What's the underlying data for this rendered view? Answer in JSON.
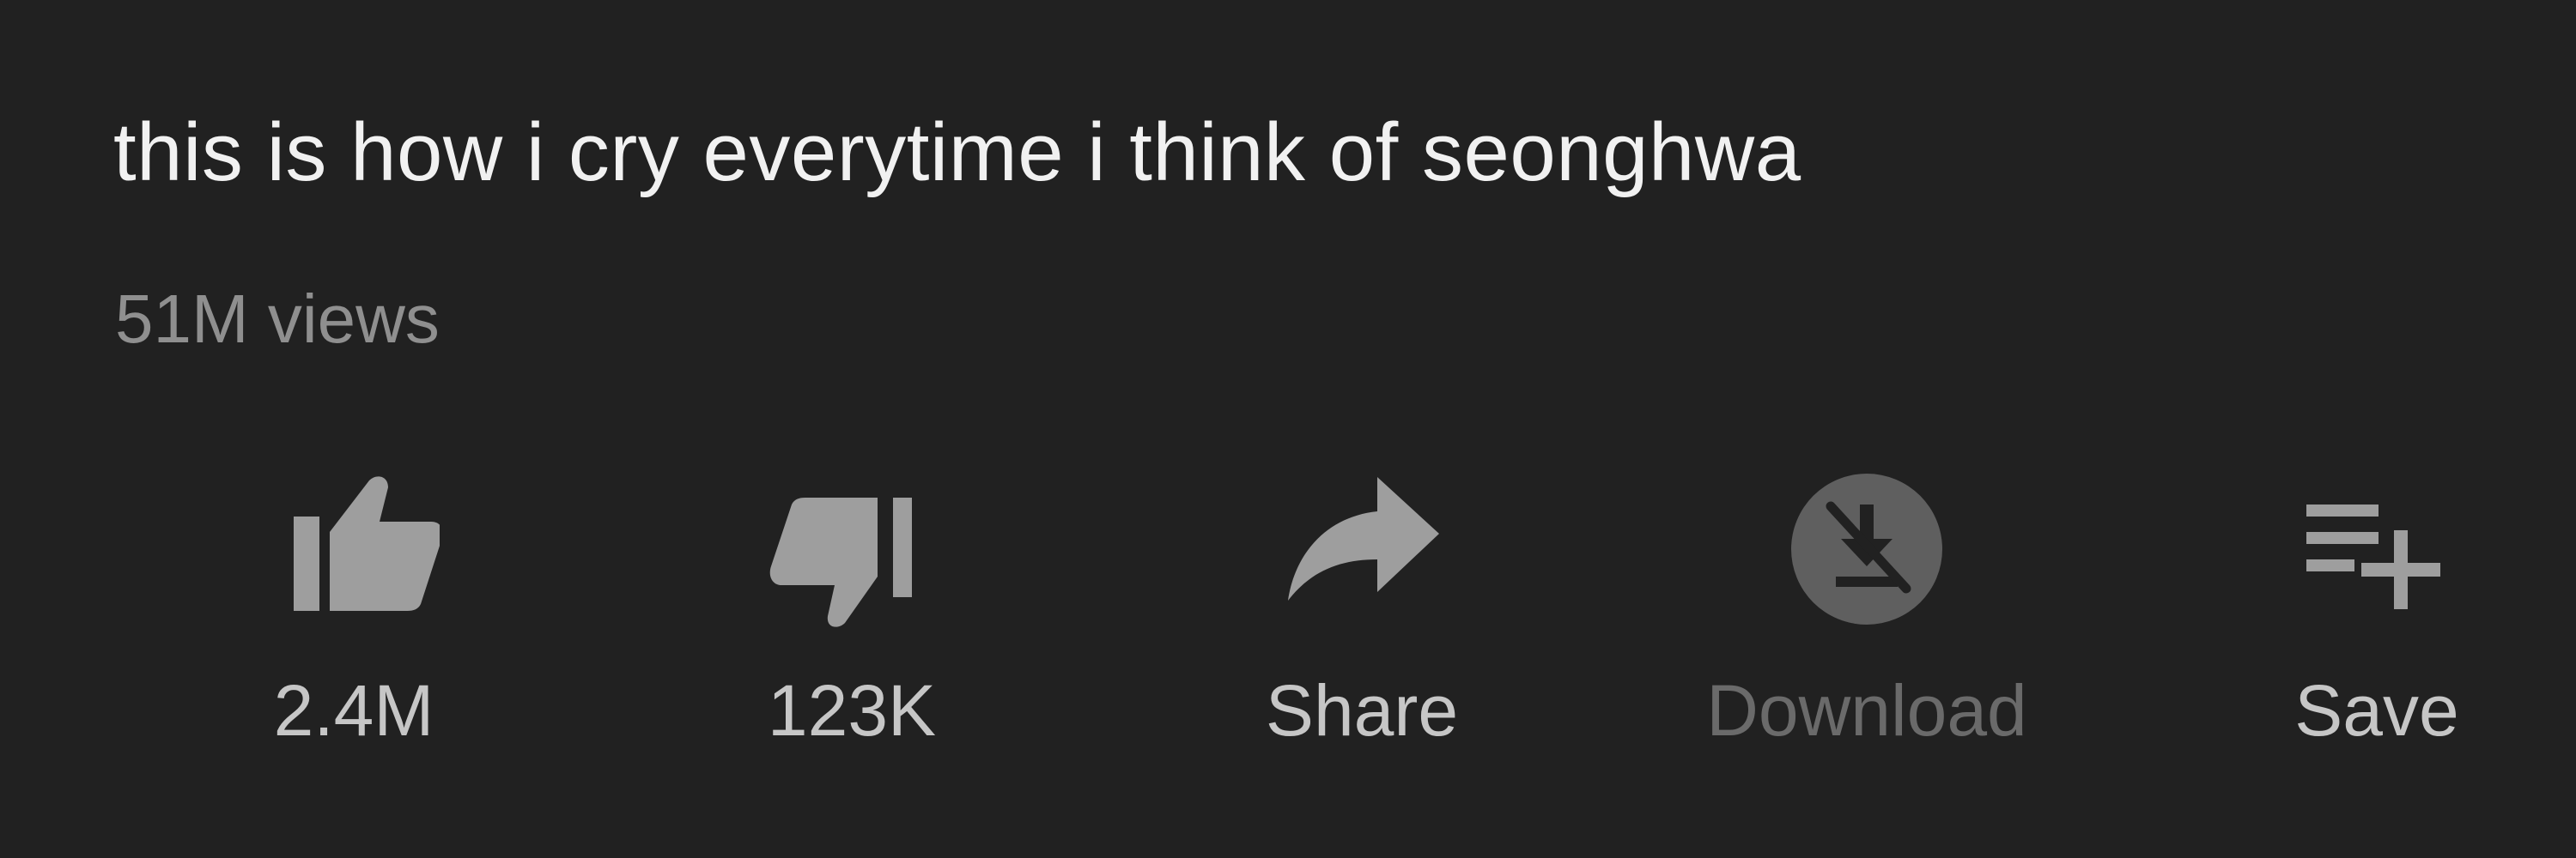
{
  "video": {
    "title": "this is how i cry everytime i think of seonghwa",
    "views": "51M views"
  },
  "actions": {
    "like": {
      "label": "2.4M",
      "icon": "thumbs-up-icon"
    },
    "dislike": {
      "label": "123K",
      "icon": "thumbs-down-icon"
    },
    "share": {
      "label": "Share",
      "icon": "share-arrow-icon"
    },
    "download": {
      "label": "Download",
      "icon": "download-disabled-icon"
    },
    "save": {
      "label": "Save",
      "icon": "playlist-add-icon"
    }
  },
  "colors": {
    "background": "#212121",
    "title": "#f1f1f1",
    "secondary_text": "#8f8f8f",
    "action_icon": "#9e9e9e",
    "disabled": "#6a6a6a"
  }
}
